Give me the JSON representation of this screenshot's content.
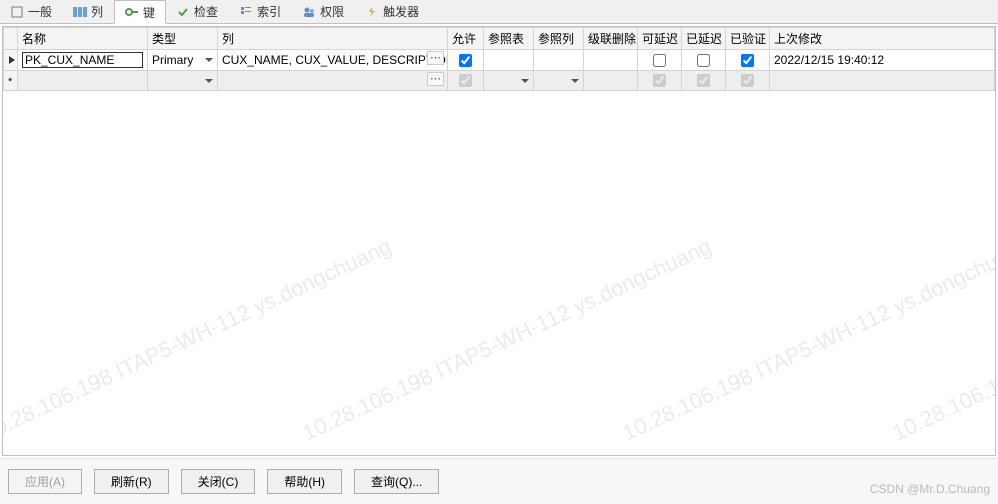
{
  "tabs": [
    {
      "label": "一般",
      "icon": "general"
    },
    {
      "label": "列",
      "icon": "columns"
    },
    {
      "label": "键",
      "icon": "keys",
      "active": true
    },
    {
      "label": "检查",
      "icon": "checks"
    },
    {
      "label": "索引",
      "icon": "indexes"
    },
    {
      "label": "权限",
      "icon": "grants"
    },
    {
      "label": "触发器",
      "icon": "triggers"
    }
  ],
  "columns": {
    "name": "名称",
    "type": "类型",
    "cols": "列",
    "allow": "允许",
    "reftab": "参照表",
    "refcol": "参照列",
    "cascade": "级联删除",
    "deferrable": "可延迟",
    "deferred": "已延迟",
    "validated": "已验证",
    "lastmod": "上次修改"
  },
  "rows": [
    {
      "name": "PK_CUX_NAME",
      "type": "Primary",
      "cols": "CUX_NAME, CUX_VALUE, DESCRIPTION",
      "allow": true,
      "reftab": "",
      "refcol": "",
      "deferrable": false,
      "deferred": false,
      "validated": true,
      "lastmod": "2022/12/15 19:40:12"
    }
  ],
  "buttons": {
    "apply": "应用(A)",
    "refresh": "刷新(R)",
    "close": "关闭(C)",
    "help": "帮助(H)",
    "query": "查询(Q)..."
  },
  "watermark": "10.28.106.198 ITAP5-WH-112 ys.dongchuang",
  "credit": "CSDN @Mr.D.Chuang"
}
